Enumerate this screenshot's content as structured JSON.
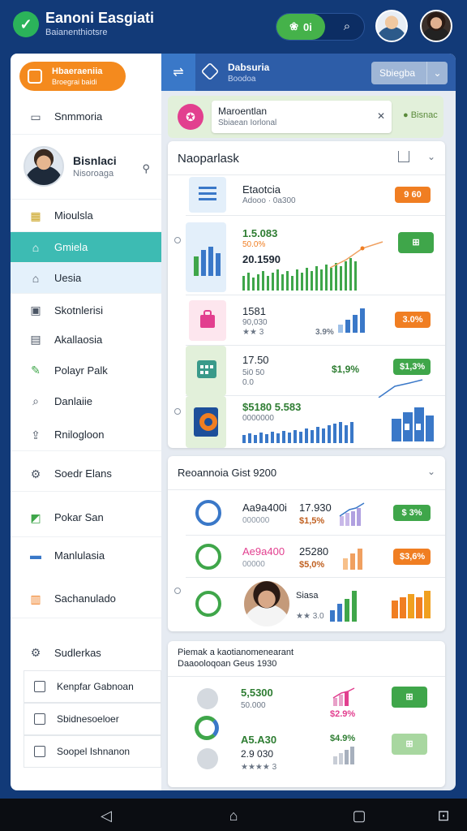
{
  "header": {
    "title": "Eanoni Easgiati",
    "subtitle": "Baianenthiotsre",
    "pill_value": "0i",
    "icons": [
      "check-logo-icon",
      "plant-icon",
      "search-icon"
    ],
    "avatars": [
      "user-avatar-1",
      "user-avatar-2"
    ]
  },
  "sidebar": {
    "primary_button": {
      "title": "Hbaeraeniia",
      "subtitle": "Broegrai baidi"
    },
    "top_item": "Snmmoria",
    "profile": {
      "name": "Bisnlaci",
      "role": "Nisoroaga"
    },
    "items": [
      {
        "label": "Mioulsla",
        "icon": "grid-icon"
      },
      {
        "label": "Gmiela",
        "icon": "home-icon"
      },
      {
        "label": "Uesia",
        "icon": "house-icon"
      },
      {
        "label": "Skotnlerisi",
        "icon": "image-icon"
      },
      {
        "label": "Akallaosia",
        "icon": "gallery-icon"
      },
      {
        "label": "Polayr Palk",
        "icon": "edit-icon"
      },
      {
        "label": "Danlaiie",
        "icon": "search-icon"
      },
      {
        "label": "Rnilogloon",
        "icon": "upload-icon"
      },
      {
        "label": "Soedr Elans",
        "icon": "gear-icon"
      },
      {
        "label": "Pokar San",
        "icon": "chart-icon"
      },
      {
        "label": "Manlulasia",
        "icon": "card-icon"
      },
      {
        "label": "Sachanulado",
        "icon": "building-icon"
      },
      {
        "label": "Sudlerkas",
        "icon": "settings-icon"
      }
    ],
    "sub_items": [
      "Kenpfar Gabnoan",
      "Sbidnesoeloer",
      "Soopel Ishnanon"
    ]
  },
  "main": {
    "header": {
      "title": "Dabsuria",
      "subtitle": "Boodoa",
      "select_label": "Sbiegba"
    },
    "notice": {
      "title": "Maroentlan",
      "subtitle": "Sbiaean Iorlonal",
      "status": "Bisnac"
    },
    "panel1": {
      "title": "Naoparlask",
      "rows": [
        {
          "title": "Etaotcia",
          "sub": "Adooo · 0a300",
          "chip": "9 60"
        },
        {
          "title": "1.5.083",
          "sub": "50.0%",
          "value2": "20.1590"
        },
        {
          "title": "1581",
          "sub": "90,030",
          "stars": "★★ 3",
          "pct": "3.9%",
          "chip": "3.0%"
        },
        {
          "title": "17.50",
          "sub": "5i0 50",
          "sub2": "0.0",
          "pct": "$1,9%",
          "chip": "$1,3%"
        },
        {
          "title": "$5180 5.583",
          "sub": "0000000"
        }
      ]
    },
    "panel2": {
      "title": "Reoannoia Gist 9200",
      "rows": [
        {
          "title": "Aa9a400i",
          "value": "17.930",
          "sub": "000000",
          "pct": "$1,5%",
          "chip": "$ 3%"
        },
        {
          "title": "Ae9a400",
          "value": "25280",
          "sub": "00000",
          "pct": "$5,0%",
          "chip": "$3,6%"
        },
        {
          "title": "Siasa",
          "stars": "★★ 3.0"
        }
      ]
    },
    "panel3": {
      "title": "Piemak a kaotianomenearant",
      "subtitle": "Daaooloqoan Geus 1930",
      "rows": [
        {
          "title": "5,5300",
          "sub": "50.000",
          "pct": "$2.9%"
        },
        {
          "title": "A5.A30",
          "sub": "2.9 030",
          "stars": "★★★★ 3",
          "pct": "$4.9%"
        }
      ]
    }
  },
  "system_nav": [
    "back-icon",
    "home-icon",
    "recents-icon",
    "more-icon"
  ]
}
